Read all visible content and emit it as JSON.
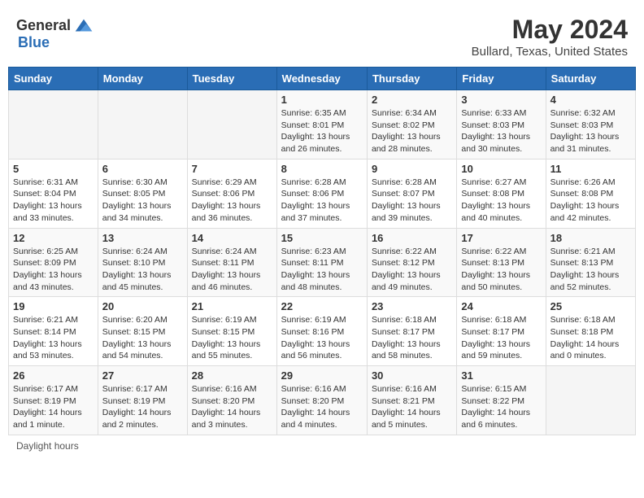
{
  "header": {
    "logo_general": "General",
    "logo_blue": "Blue",
    "month_year": "May 2024",
    "location": "Bullard, Texas, United States"
  },
  "weekdays": [
    "Sunday",
    "Monday",
    "Tuesday",
    "Wednesday",
    "Thursday",
    "Friday",
    "Saturday"
  ],
  "footer": {
    "daylight_hours": "Daylight hours"
  },
  "weeks": [
    [
      {
        "day": "",
        "sunrise": "",
        "sunset": "",
        "daylight": "",
        "empty": true
      },
      {
        "day": "",
        "sunrise": "",
        "sunset": "",
        "daylight": "",
        "empty": true
      },
      {
        "day": "",
        "sunrise": "",
        "sunset": "",
        "daylight": "",
        "empty": true
      },
      {
        "day": "1",
        "sunrise": "Sunrise: 6:35 AM",
        "sunset": "Sunset: 8:01 PM",
        "daylight": "Daylight: 13 hours and 26 minutes."
      },
      {
        "day": "2",
        "sunrise": "Sunrise: 6:34 AM",
        "sunset": "Sunset: 8:02 PM",
        "daylight": "Daylight: 13 hours and 28 minutes."
      },
      {
        "day": "3",
        "sunrise": "Sunrise: 6:33 AM",
        "sunset": "Sunset: 8:03 PM",
        "daylight": "Daylight: 13 hours and 30 minutes."
      },
      {
        "day": "4",
        "sunrise": "Sunrise: 6:32 AM",
        "sunset": "Sunset: 8:03 PM",
        "daylight": "Daylight: 13 hours and 31 minutes."
      }
    ],
    [
      {
        "day": "5",
        "sunrise": "Sunrise: 6:31 AM",
        "sunset": "Sunset: 8:04 PM",
        "daylight": "Daylight: 13 hours and 33 minutes."
      },
      {
        "day": "6",
        "sunrise": "Sunrise: 6:30 AM",
        "sunset": "Sunset: 8:05 PM",
        "daylight": "Daylight: 13 hours and 34 minutes."
      },
      {
        "day": "7",
        "sunrise": "Sunrise: 6:29 AM",
        "sunset": "Sunset: 8:06 PM",
        "daylight": "Daylight: 13 hours and 36 minutes."
      },
      {
        "day": "8",
        "sunrise": "Sunrise: 6:28 AM",
        "sunset": "Sunset: 8:06 PM",
        "daylight": "Daylight: 13 hours and 37 minutes."
      },
      {
        "day": "9",
        "sunrise": "Sunrise: 6:28 AM",
        "sunset": "Sunset: 8:07 PM",
        "daylight": "Daylight: 13 hours and 39 minutes."
      },
      {
        "day": "10",
        "sunrise": "Sunrise: 6:27 AM",
        "sunset": "Sunset: 8:08 PM",
        "daylight": "Daylight: 13 hours and 40 minutes."
      },
      {
        "day": "11",
        "sunrise": "Sunrise: 6:26 AM",
        "sunset": "Sunset: 8:08 PM",
        "daylight": "Daylight: 13 hours and 42 minutes."
      }
    ],
    [
      {
        "day": "12",
        "sunrise": "Sunrise: 6:25 AM",
        "sunset": "Sunset: 8:09 PM",
        "daylight": "Daylight: 13 hours and 43 minutes."
      },
      {
        "day": "13",
        "sunrise": "Sunrise: 6:24 AM",
        "sunset": "Sunset: 8:10 PM",
        "daylight": "Daylight: 13 hours and 45 minutes."
      },
      {
        "day": "14",
        "sunrise": "Sunrise: 6:24 AM",
        "sunset": "Sunset: 8:11 PM",
        "daylight": "Daylight: 13 hours and 46 minutes."
      },
      {
        "day": "15",
        "sunrise": "Sunrise: 6:23 AM",
        "sunset": "Sunset: 8:11 PM",
        "daylight": "Daylight: 13 hours and 48 minutes."
      },
      {
        "day": "16",
        "sunrise": "Sunrise: 6:22 AM",
        "sunset": "Sunset: 8:12 PM",
        "daylight": "Daylight: 13 hours and 49 minutes."
      },
      {
        "day": "17",
        "sunrise": "Sunrise: 6:22 AM",
        "sunset": "Sunset: 8:13 PM",
        "daylight": "Daylight: 13 hours and 50 minutes."
      },
      {
        "day": "18",
        "sunrise": "Sunrise: 6:21 AM",
        "sunset": "Sunset: 8:13 PM",
        "daylight": "Daylight: 13 hours and 52 minutes."
      }
    ],
    [
      {
        "day": "19",
        "sunrise": "Sunrise: 6:21 AM",
        "sunset": "Sunset: 8:14 PM",
        "daylight": "Daylight: 13 hours and 53 minutes."
      },
      {
        "day": "20",
        "sunrise": "Sunrise: 6:20 AM",
        "sunset": "Sunset: 8:15 PM",
        "daylight": "Daylight: 13 hours and 54 minutes."
      },
      {
        "day": "21",
        "sunrise": "Sunrise: 6:19 AM",
        "sunset": "Sunset: 8:15 PM",
        "daylight": "Daylight: 13 hours and 55 minutes."
      },
      {
        "day": "22",
        "sunrise": "Sunrise: 6:19 AM",
        "sunset": "Sunset: 8:16 PM",
        "daylight": "Daylight: 13 hours and 56 minutes."
      },
      {
        "day": "23",
        "sunrise": "Sunrise: 6:18 AM",
        "sunset": "Sunset: 8:17 PM",
        "daylight": "Daylight: 13 hours and 58 minutes."
      },
      {
        "day": "24",
        "sunrise": "Sunrise: 6:18 AM",
        "sunset": "Sunset: 8:17 PM",
        "daylight": "Daylight: 13 hours and 59 minutes."
      },
      {
        "day": "25",
        "sunrise": "Sunrise: 6:18 AM",
        "sunset": "Sunset: 8:18 PM",
        "daylight": "Daylight: 14 hours and 0 minutes."
      }
    ],
    [
      {
        "day": "26",
        "sunrise": "Sunrise: 6:17 AM",
        "sunset": "Sunset: 8:19 PM",
        "daylight": "Daylight: 14 hours and 1 minute."
      },
      {
        "day": "27",
        "sunrise": "Sunrise: 6:17 AM",
        "sunset": "Sunset: 8:19 PM",
        "daylight": "Daylight: 14 hours and 2 minutes."
      },
      {
        "day": "28",
        "sunrise": "Sunrise: 6:16 AM",
        "sunset": "Sunset: 8:20 PM",
        "daylight": "Daylight: 14 hours and 3 minutes."
      },
      {
        "day": "29",
        "sunrise": "Sunrise: 6:16 AM",
        "sunset": "Sunset: 8:20 PM",
        "daylight": "Daylight: 14 hours and 4 minutes."
      },
      {
        "day": "30",
        "sunrise": "Sunrise: 6:16 AM",
        "sunset": "Sunset: 8:21 PM",
        "daylight": "Daylight: 14 hours and 5 minutes."
      },
      {
        "day": "31",
        "sunrise": "Sunrise: 6:15 AM",
        "sunset": "Sunset: 8:22 PM",
        "daylight": "Daylight: 14 hours and 6 minutes."
      },
      {
        "day": "",
        "sunrise": "",
        "sunset": "",
        "daylight": "",
        "empty": true
      }
    ]
  ]
}
